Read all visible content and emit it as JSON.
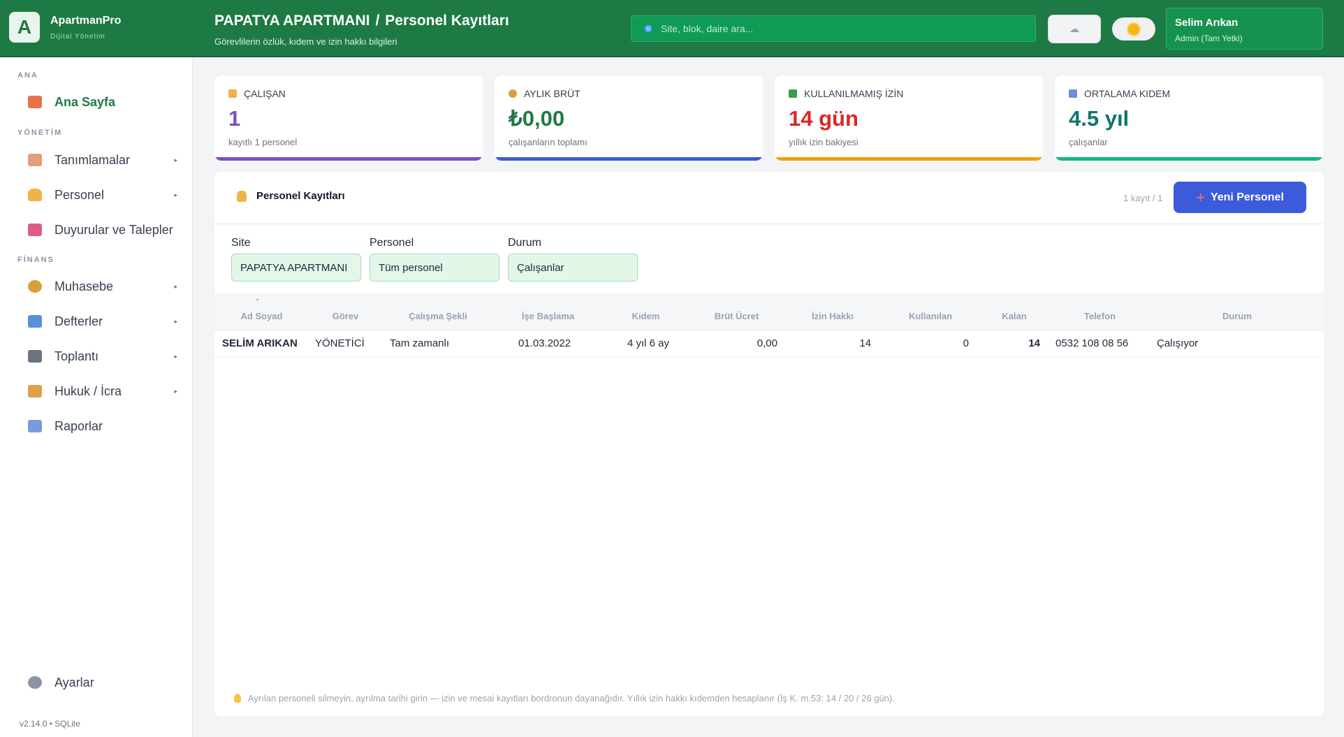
{
  "brand": {
    "logo_letter": "A",
    "name": "ApartmanPro",
    "sub": "Dijital Yönetim"
  },
  "header": {
    "site": "PAPATYA APARTMANI",
    "separator": "/",
    "title": "Personel Kayıtları",
    "subtitle": "Görevlilerin özlük, kıdem ve izin hakkı bilgileri",
    "search_placeholder": "Site, blok, daire ara...",
    "cloud_icon": "cloud-icon",
    "theme_icon": "sun-icon"
  },
  "user": {
    "name": "Selim Arıkan",
    "role": "Admin (Tam Yetki)"
  },
  "sidebar": {
    "sections": [
      "ANA",
      "YÖNETİM",
      "FİNANS"
    ],
    "items": [
      {
        "label": "Ana Sayfa",
        "icon": "home-icon",
        "color": "#e8734a"
      },
      {
        "label": "Tanımlamalar",
        "icon": "clipboard-icon",
        "color": "#e2a07a"
      },
      {
        "label": "Personel",
        "icon": "person-icon",
        "color": "#f0b34a"
      },
      {
        "label": "Duyurular ve Talepler",
        "icon": "megaphone-icon",
        "color": "#e05a8a"
      },
      {
        "label": "Muhasebe",
        "icon": "money-bag-icon",
        "color": "#d9a03a"
      },
      {
        "label": "Defterler",
        "icon": "chart-icon",
        "color": "#5a8fd9"
      },
      {
        "label": "Toplantı",
        "icon": "clapper-icon",
        "color": "#6b7280"
      },
      {
        "label": "Hukuk / İcra",
        "icon": "scales-icon",
        "color": "#e0a04a"
      },
      {
        "label": "Raporlar",
        "icon": "trend-icon",
        "color": "#7a9bd9"
      },
      {
        "label": "Ayarlar",
        "icon": "gear-icon",
        "color": "#8a94a3"
      }
    ],
    "footer": "v2.14.0  •  SQLite"
  },
  "stats": [
    {
      "label": "ÇALIŞAN",
      "value": "1",
      "note": "kayıtlı 1 personel",
      "color": "#7c4dcc",
      "icon_color": "#f0b34a"
    },
    {
      "label": "AYLIK BRÜT",
      "value": "₺0,00",
      "note": "çalışanların toplamı",
      "color": "#1e7a44",
      "bar": "#3b5bdb",
      "icon_color": "#d9a03a"
    },
    {
      "label": "KULLANILMAMIŞ İZİN",
      "value": "14 gün",
      "note": "yıllık izin bakiyesi",
      "color": "#dc2626",
      "bar": "#f59e0b",
      "icon_color": "#3f9a4a"
    },
    {
      "label": "ORTALAMA KIDEM",
      "value": "4.5 yıl",
      "note": "çalışanlar",
      "color": "#0f766e",
      "bar": "#10b981",
      "icon_color": "#6b8fd9"
    }
  ],
  "panel": {
    "title": "Personel Kayıtları",
    "count": "1 kayıt / 1",
    "new_button": "Yeni Personel",
    "filters": {
      "site_label": "Site",
      "site_value": "PAPATYA APARTMANI",
      "personel_label": "Personel",
      "personel_value": "Tüm personel",
      "durum_label": "Durum",
      "durum_value": "Çalışanlar"
    },
    "columns": [
      "Ad Soyad",
      "Görev",
      "Çalışma Şekli",
      "İşe Başlama",
      "Kıdem",
      "Brüt Ücret",
      "İzin Hakkı",
      "Kullanılan",
      "Kalan",
      "Telefon",
      "Durum"
    ],
    "rows": [
      [
        "SELİM ARIKAN",
        "YÖNETİCİ",
        "Tam zamanlı",
        "01.03.2022",
        "4 yıl 6 ay",
        "0,00",
        "14",
        "0",
        "14",
        "0532 108 08 56",
        "Çalışıyor"
      ]
    ],
    "footnote": "Ayrılan personeli silmeyin, ayrılma tarihi girin — izin ve mesai kayıtları bordronun dayanağıdır. Yıllık izin hakkı kıdemden hesaplanır (İş K. m.53: 14 / 20 / 26 gün)."
  }
}
